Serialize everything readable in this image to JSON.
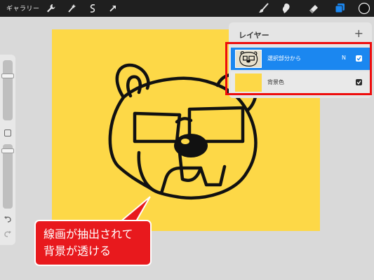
{
  "topbar": {
    "gallery_label": "ギャラリー",
    "left_tools": [
      "wrench-icon",
      "magic-wand-icon",
      "selection-icon",
      "transform-arrow-icon"
    ],
    "right_tools": [
      "brush-icon",
      "smudge-icon",
      "eraser-icon",
      "layers-icon",
      "color-swatch-icon"
    ],
    "current_color": "#111111",
    "active_tool_color": "#1b87f0"
  },
  "layers_panel": {
    "title": "レイヤー",
    "add_label": "+",
    "layers": [
      {
        "name": "選択部分から",
        "blend_mode": "N",
        "visible": true,
        "selected": true
      },
      {
        "name": "背景色",
        "visible": true,
        "selected": false
      }
    ]
  },
  "callout": {
    "line1": "線画が抽出されて",
    "line2": "背景が透ける"
  },
  "colors": {
    "canvas": "#fdd847",
    "accent": "#1b87f0",
    "highlight": "#ee0d0d",
    "callout": "#e8191d"
  }
}
